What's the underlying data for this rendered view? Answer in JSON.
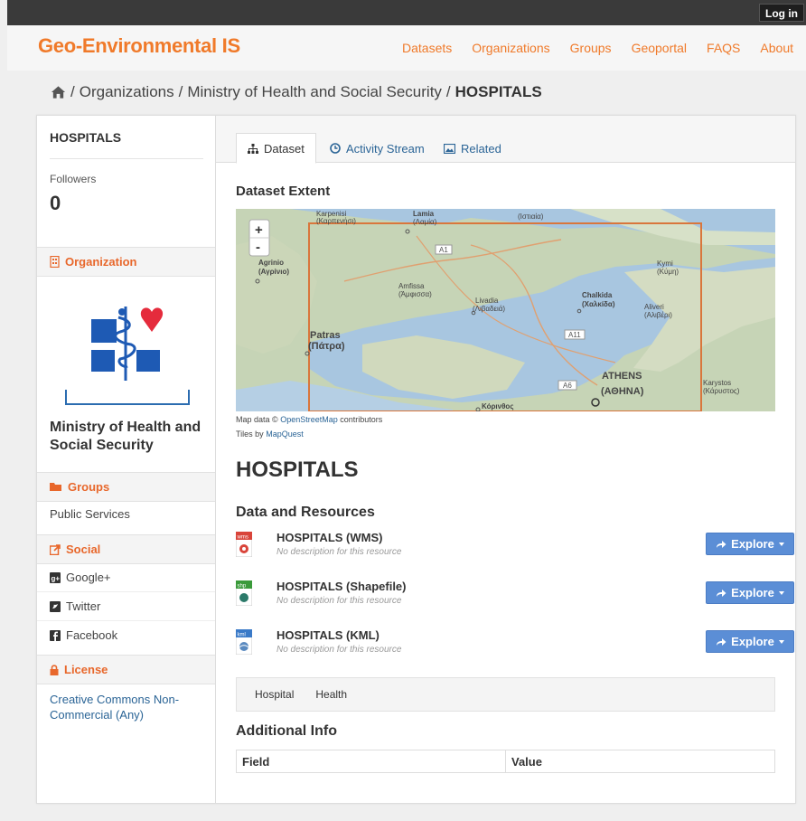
{
  "topbar": {
    "login_label": "Log in"
  },
  "site": {
    "brand": "Geo-Environmental IS"
  },
  "nav": {
    "items": [
      "Datasets",
      "Organizations",
      "Groups",
      "Geoportal",
      "FAQS",
      "About"
    ]
  },
  "breadcrumb": {
    "sep": "/",
    "items": [
      "Organizations",
      "Ministry of Health and Social Security"
    ],
    "current": "HOSPITALS"
  },
  "sidebar": {
    "title": "HOSPITALS",
    "followers_label": "Followers",
    "followers_count": "0",
    "organization_heading": "Organization",
    "organization_name": "Ministry of Health and Social Security",
    "groups_heading": "Groups",
    "groups": [
      "Public Services"
    ],
    "social_heading": "Social",
    "social": [
      "Google+",
      "Twitter",
      "Facebook"
    ],
    "license_heading": "License",
    "license": "Creative Commons Non-Commercial (Any)"
  },
  "tabs": [
    {
      "label": "Dataset",
      "icon": "sitemap-icon"
    },
    {
      "label": "Activity Stream",
      "icon": "clock-icon"
    },
    {
      "label": "Related",
      "icon": "picture-icon"
    }
  ],
  "extent": {
    "heading": "Dataset Extent",
    "zoom_in": "+",
    "zoom_out": "-",
    "credit_prefix": "Map data ©",
    "credit_link": "OpenStreetMap",
    "credit_suffix": "contributors",
    "tiles_prefix": "Tiles by",
    "tiles_link": "MapQuest",
    "places": [
      "Karpenisi",
      "(Καρπενήσι)",
      "Lamia",
      "(Λαμία)",
      "(Ιστιαία)",
      "Agrinio",
      "(Αγρίνιο)",
      "Amfissa",
      "(Άμφισσα)",
      "Livadia",
      "(Λιβαδειά)",
      "Chalkida",
      "(Χαλκίδα)",
      "Kymi",
      "(Κύμη)",
      "Aliveri",
      "(Αλιβέρι)",
      "Patras",
      "(Πάτρα)",
      "ATHENS",
      "(ΑΘΗΝΑ)",
      "Karystos",
      "(Κάρυστος)",
      "Κόρινθος"
    ],
    "roads": [
      "A1",
      "A11",
      "A6"
    ]
  },
  "dataset": {
    "title": "HOSPITALS"
  },
  "resources": {
    "heading": "Data and Resources",
    "explore_label": "Explore",
    "items": [
      {
        "name": "HOSPITALS (WMS)",
        "desc": "No description for this resource",
        "format": "wms",
        "color": "#d9443a"
      },
      {
        "name": "HOSPITALS (Shapefile)",
        "desc": "No description for this resource",
        "format": "shp",
        "color": "#3a9a3a"
      },
      {
        "name": "HOSPITALS (KML)",
        "desc": "No description for this resource",
        "format": "kml",
        "color": "#3a7ac8"
      }
    ]
  },
  "tags": [
    "Hospital",
    "Health"
  ],
  "additional_info": {
    "heading": "Additional Info",
    "col_field": "Field",
    "col_value": "Value"
  },
  "colors": {
    "accent": "#f07a2a",
    "link": "#2a6496",
    "button": "#5b8ed6"
  }
}
